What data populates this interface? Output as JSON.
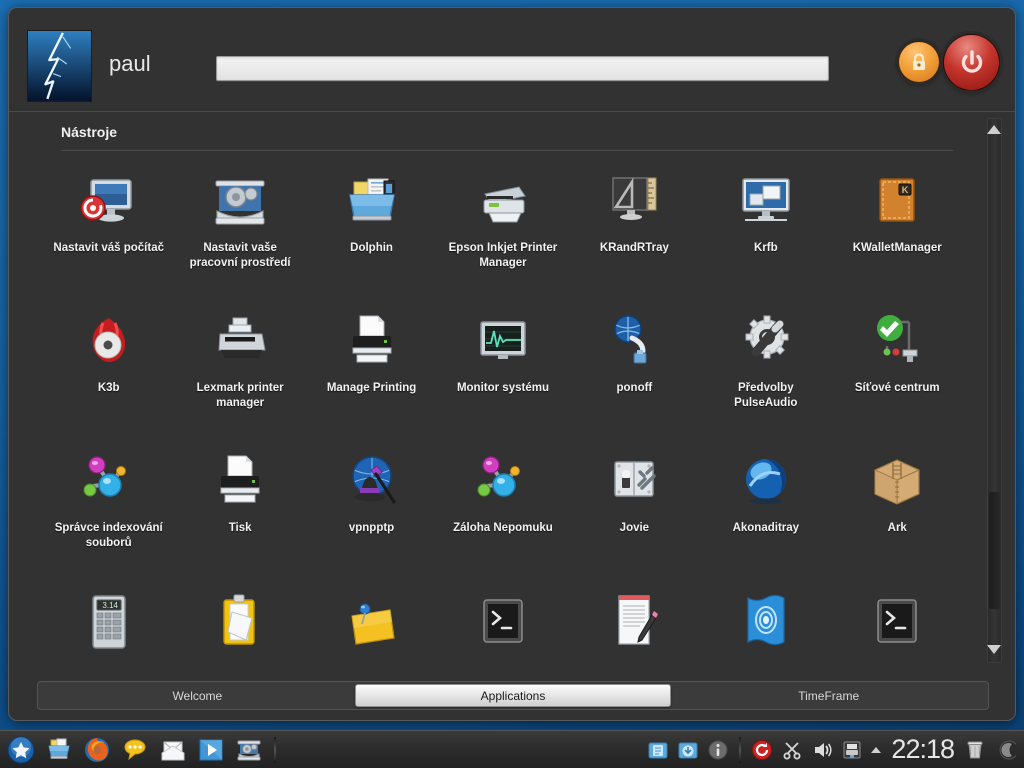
{
  "desktop": {
    "background_color": "#0d4f8c"
  },
  "header": {
    "username": "paul",
    "avatar_icon": "lightning-avatar",
    "search": {
      "value": "",
      "placeholder": ""
    },
    "lock_button": {
      "icon": "lock-icon",
      "color": "#f3a13a"
    },
    "power_button": {
      "icon": "power-icon",
      "color": "#c5352c"
    }
  },
  "content": {
    "group_title": "Nástroje",
    "rows": [
      [
        {
          "label": "Nastavit váš počítač",
          "icon": "system-settings-icon"
        },
        {
          "label": "Nastavit vaše pracovní prostředí",
          "icon": "desktop-settings-icon"
        },
        {
          "label": "Dolphin",
          "icon": "dolphin-folder-icon"
        },
        {
          "label": "Epson Inkjet Printer Manager",
          "icon": "printer-epson-icon"
        },
        {
          "label": "KRandRTray",
          "icon": "krandrtray-icon"
        },
        {
          "label": "Krfb",
          "icon": "krfb-desktop-sharing-icon"
        },
        {
          "label": "KWalletManager",
          "icon": "kwallet-icon"
        }
      ],
      [
        {
          "label": "K3b",
          "icon": "k3b-icon"
        },
        {
          "label": "Lexmark printer manager",
          "icon": "printer-lexmark-icon"
        },
        {
          "label": "Manage Printing",
          "icon": "manage-printing-icon"
        },
        {
          "label": "Monitor systému",
          "icon": "system-monitor-icon"
        },
        {
          "label": "ponoff",
          "icon": "ponoff-network-icon"
        },
        {
          "label": "Předvolby PulseAudio",
          "icon": "pulseaudio-prefs-icon"
        },
        {
          "label": "Síťové centrum",
          "icon": "network-center-icon"
        }
      ],
      [
        {
          "label": "Správce indexování souborů",
          "icon": "nepomuk-indexer-icon"
        },
        {
          "label": "Tisk",
          "icon": "print-icon"
        },
        {
          "label": "vpnpptp",
          "icon": "vpnpptp-icon"
        },
        {
          "label": "Záloha Nepomuku",
          "icon": "nepomuk-backup-icon"
        },
        {
          "label": "Jovie",
          "icon": "jovie-icon"
        },
        {
          "label": "Akonaditray",
          "icon": "akonaditray-icon"
        },
        {
          "label": "Ark",
          "icon": "ark-archive-icon"
        }
      ],
      [
        {
          "label": "",
          "icon": "calculator-icon"
        },
        {
          "label": "",
          "icon": "clipboard-icon"
        },
        {
          "label": "",
          "icon": "sticky-note-icon"
        },
        {
          "label": "",
          "icon": "terminal-icon"
        },
        {
          "label": "",
          "icon": "text-editor-icon"
        },
        {
          "label": "",
          "icon": "blue-disc-icon"
        },
        {
          "label": "",
          "icon": "terminal-icon"
        }
      ]
    ]
  },
  "scrollbar": {
    "up_arrow": "triangle-up-icon",
    "down_arrow": "triangle-down-icon"
  },
  "tabs": [
    {
      "label": "Welcome",
      "active": false
    },
    {
      "label": "Applications",
      "active": true
    },
    {
      "label": "TimeFrame",
      "active": false
    }
  ],
  "taskbar": {
    "launchers": [
      {
        "icon": "kickoff-star-icon"
      },
      {
        "icon": "file-manager-icon"
      },
      {
        "icon": "firefox-icon"
      },
      {
        "icon": "chat-icon"
      },
      {
        "icon": "mail-icon"
      },
      {
        "icon": "media-player-icon"
      },
      {
        "icon": "settings-icon"
      }
    ],
    "tray": [
      {
        "icon": "folder-blue-icon"
      },
      {
        "icon": "folder-download-icon"
      },
      {
        "icon": "info-icon"
      },
      {
        "icon": "update-icon"
      },
      {
        "icon": "klipper-scissors-icon"
      },
      {
        "icon": "volume-icon"
      },
      {
        "icon": "printer-tray-icon"
      },
      {
        "icon": "tray-expand-arrow-icon"
      }
    ],
    "clock": "22:18",
    "trash_icon": "trash-icon",
    "pager_icon": "pager-icon"
  }
}
